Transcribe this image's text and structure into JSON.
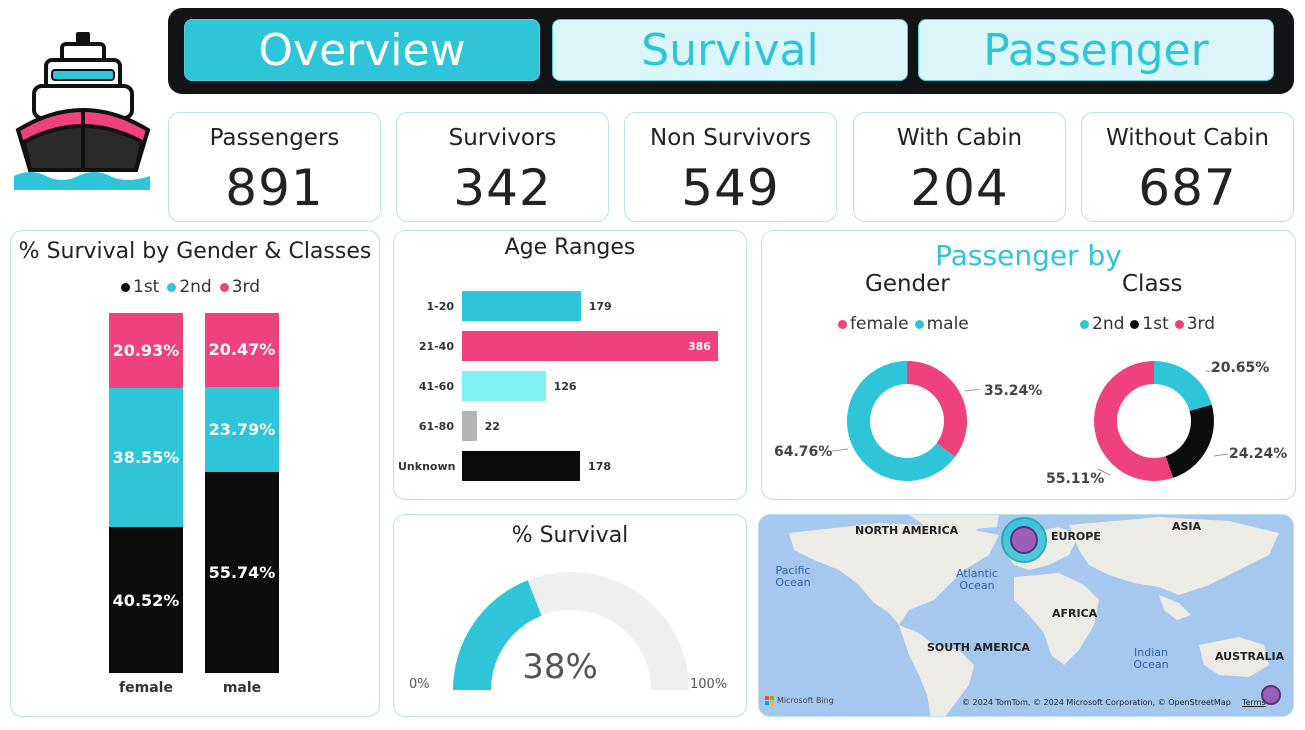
{
  "nav": {
    "tabs": [
      {
        "label": "Overview"
      },
      {
        "label": "Survival"
      },
      {
        "label": "Passenger"
      }
    ]
  },
  "kpis": [
    {
      "label": "Passengers",
      "value": "891"
    },
    {
      "label": "Survivors",
      "value": "342"
    },
    {
      "label": "Non Survivors",
      "value": "549"
    },
    {
      "label": "With Cabin",
      "value": "204"
    },
    {
      "label": "Without Cabin",
      "value": "687"
    }
  ],
  "colors": {
    "accent": "#2ec5d8",
    "pink": "#f0417f",
    "black": "#0c0c0c",
    "light_cyan": "#7ff0f4",
    "gray": "#b3b3b3"
  },
  "chart_data": [
    {
      "type": "bar",
      "stacked": true,
      "title": "% Survival by Gender & Classes",
      "legend": [
        "1st",
        "2nd",
        "3rd"
      ],
      "categories": [
        "female",
        "male"
      ],
      "series": [
        {
          "name": "1st",
          "values": [
            40.52,
            55.74
          ],
          "labels": [
            "40.52%",
            "55.74%"
          ]
        },
        {
          "name": "2nd",
          "values": [
            38.55,
            23.79
          ],
          "labels": [
            "38.55%",
            "23.79%"
          ]
        },
        {
          "name": "3rd",
          "values": [
            20.93,
            20.47
          ],
          "labels": [
            "20.93%",
            "20.47%"
          ]
        }
      ]
    },
    {
      "type": "bar",
      "orientation": "horizontal",
      "title": "Age Ranges",
      "categories": [
        "1-20",
        "21-40",
        "41-60",
        "61-80",
        "Unknown"
      ],
      "values": [
        179,
        386,
        126,
        22,
        178
      ]
    },
    {
      "type": "pie",
      "title": "Passenger by",
      "subtitle": "Gender",
      "legend": [
        "female",
        "male"
      ],
      "values": [
        35.24,
        64.76
      ],
      "labels": [
        "35.24%",
        "64.76%"
      ]
    },
    {
      "type": "pie",
      "subtitle": "Class",
      "legend": [
        "2nd",
        "1st",
        "3rd"
      ],
      "values": [
        20.65,
        24.24,
        55.11
      ],
      "labels": [
        "20.65%",
        "24.24%",
        "55.11%"
      ]
    },
    {
      "type": "gauge",
      "title": "% Survival",
      "value": 38,
      "min_label": "0%",
      "max_label": "100%",
      "value_label": "38%"
    }
  ],
  "map": {
    "labels": {
      "north_america": "NORTH AMERICA",
      "europe": "EUROPE",
      "asia": "ASIA",
      "africa": "AFRICA",
      "south_america": "SOUTH AMERICA",
      "australia": "AUSTRALIA"
    },
    "oceans": {
      "pacific": "Pacific Ocean",
      "atlantic": "Atlantic Ocean",
      "indian": "Indian Ocean"
    },
    "attribution": "© 2024 TomTom, © 2024 Microsoft Corporation, © OpenStreetMap",
    "terms": "Terms",
    "brand": "Microsoft Bing"
  }
}
